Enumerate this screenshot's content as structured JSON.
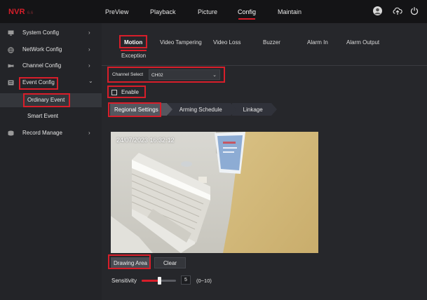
{
  "header": {
    "brand": "NVR",
    "version": "6.6",
    "nav": [
      {
        "label": "PreView",
        "active": false
      },
      {
        "label": "Playback",
        "active": false
      },
      {
        "label": "Picture",
        "active": false
      },
      {
        "label": "Config",
        "active": true
      },
      {
        "label": "Maintain",
        "active": false
      }
    ],
    "icons": [
      "user-avatar-icon",
      "cloud-upload-icon",
      "power-icon"
    ]
  },
  "sidebar": {
    "items": [
      {
        "label": "System Config",
        "icon": "system-config-icon",
        "expanded": false
      },
      {
        "label": "NetWork Config",
        "icon": "network-config-icon",
        "expanded": false
      },
      {
        "label": "Channel Config",
        "icon": "channel-config-icon",
        "expanded": false
      },
      {
        "label": "Event Config",
        "icon": "event-config-icon",
        "expanded": true
      },
      {
        "label": "Record Manage",
        "icon": "record-manage-icon",
        "expanded": false
      }
    ],
    "subitems": [
      {
        "label": "Ordinary Event",
        "active": true
      },
      {
        "label": "Smart Event",
        "active": false
      }
    ],
    "chevron_right": "›",
    "chevron_down": "⌄"
  },
  "tabs": {
    "row1": [
      "Motion",
      "Video Tampering",
      "Video Loss",
      "Buzzer",
      "Alarm In",
      "Alarm Output"
    ],
    "row2": [
      "Exception"
    ],
    "active": "Motion"
  },
  "form": {
    "channel_label": "Channel Select",
    "channel_value": "CH02",
    "enable_label": "Enable",
    "enable_checked": false
  },
  "subtabs": [
    "Regional Settings",
    "Arming Schedule",
    "Linkage"
  ],
  "video": {
    "timestamp": "24/07/2023 16:32:12"
  },
  "buttons": {
    "drawing_area": "Drawing Area",
    "clear": "Clear"
  },
  "sensitivity": {
    "label": "Sensitivity",
    "value": "5",
    "level": 0.5,
    "range": "(0~10)"
  },
  "colors": {
    "accent": "#d81e2a",
    "topbar": "#141416",
    "sidebar": "#232428",
    "panel": "#26272b"
  }
}
